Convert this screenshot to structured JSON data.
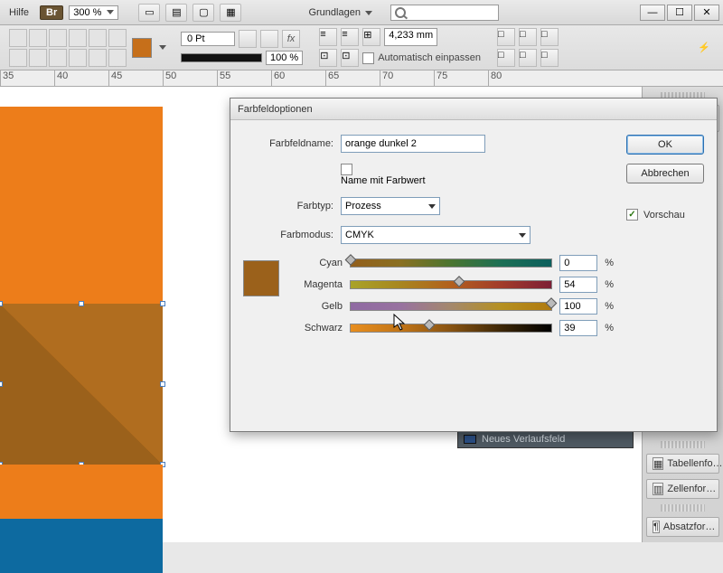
{
  "menubar": {
    "help": "Hilfe",
    "br_badge": "Br",
    "zoom": "300 %",
    "workspace": "Grundlagen",
    "search_placeholder": ""
  },
  "optbar": {
    "stroke": "0 Pt",
    "opacity": "100 %",
    "measure": "4,233 mm",
    "auto_fit": "Automatisch einpassen"
  },
  "ruler": [
    "35",
    "40",
    "45",
    "50",
    "55",
    "60",
    "65",
    "70",
    "75",
    "80"
  ],
  "dark_strip": "Neues Verlaufsfeld",
  "right_panel": {
    "items": [
      "Tabellenfo…",
      "Zellenfor…",
      "Absatzfor…"
    ]
  },
  "dialog": {
    "title": "Farbfeldoptionen",
    "name_label": "Farbfeldname:",
    "name_value": "orange dunkel 2",
    "name_with_value_label": "Name mit Farbwert",
    "name_with_value_checked": false,
    "color_type_label": "Farbtyp:",
    "color_type_value": "Prozess",
    "color_mode_label": "Farbmodus:",
    "color_mode_value": "CMYK",
    "swatch_color": "#9b611b",
    "sliders": [
      {
        "label": "Cyan",
        "value": 0
      },
      {
        "label": "Magenta",
        "value": 54
      },
      {
        "label": "Gelb",
        "value": 100
      },
      {
        "label": "Schwarz",
        "value": 39
      }
    ],
    "percent": "%",
    "ok": "OK",
    "cancel": "Abbrechen",
    "preview": "Vorschau",
    "preview_checked": true
  },
  "chart_data": {
    "type": "table",
    "title": "CMYK values for swatch 'orange dunkel 2'",
    "rows": [
      {
        "channel": "Cyan",
        "value_pct": 0
      },
      {
        "channel": "Magenta",
        "value_pct": 54
      },
      {
        "channel": "Gelb",
        "value_pct": 100
      },
      {
        "channel": "Schwarz",
        "value_pct": 39
      }
    ]
  }
}
